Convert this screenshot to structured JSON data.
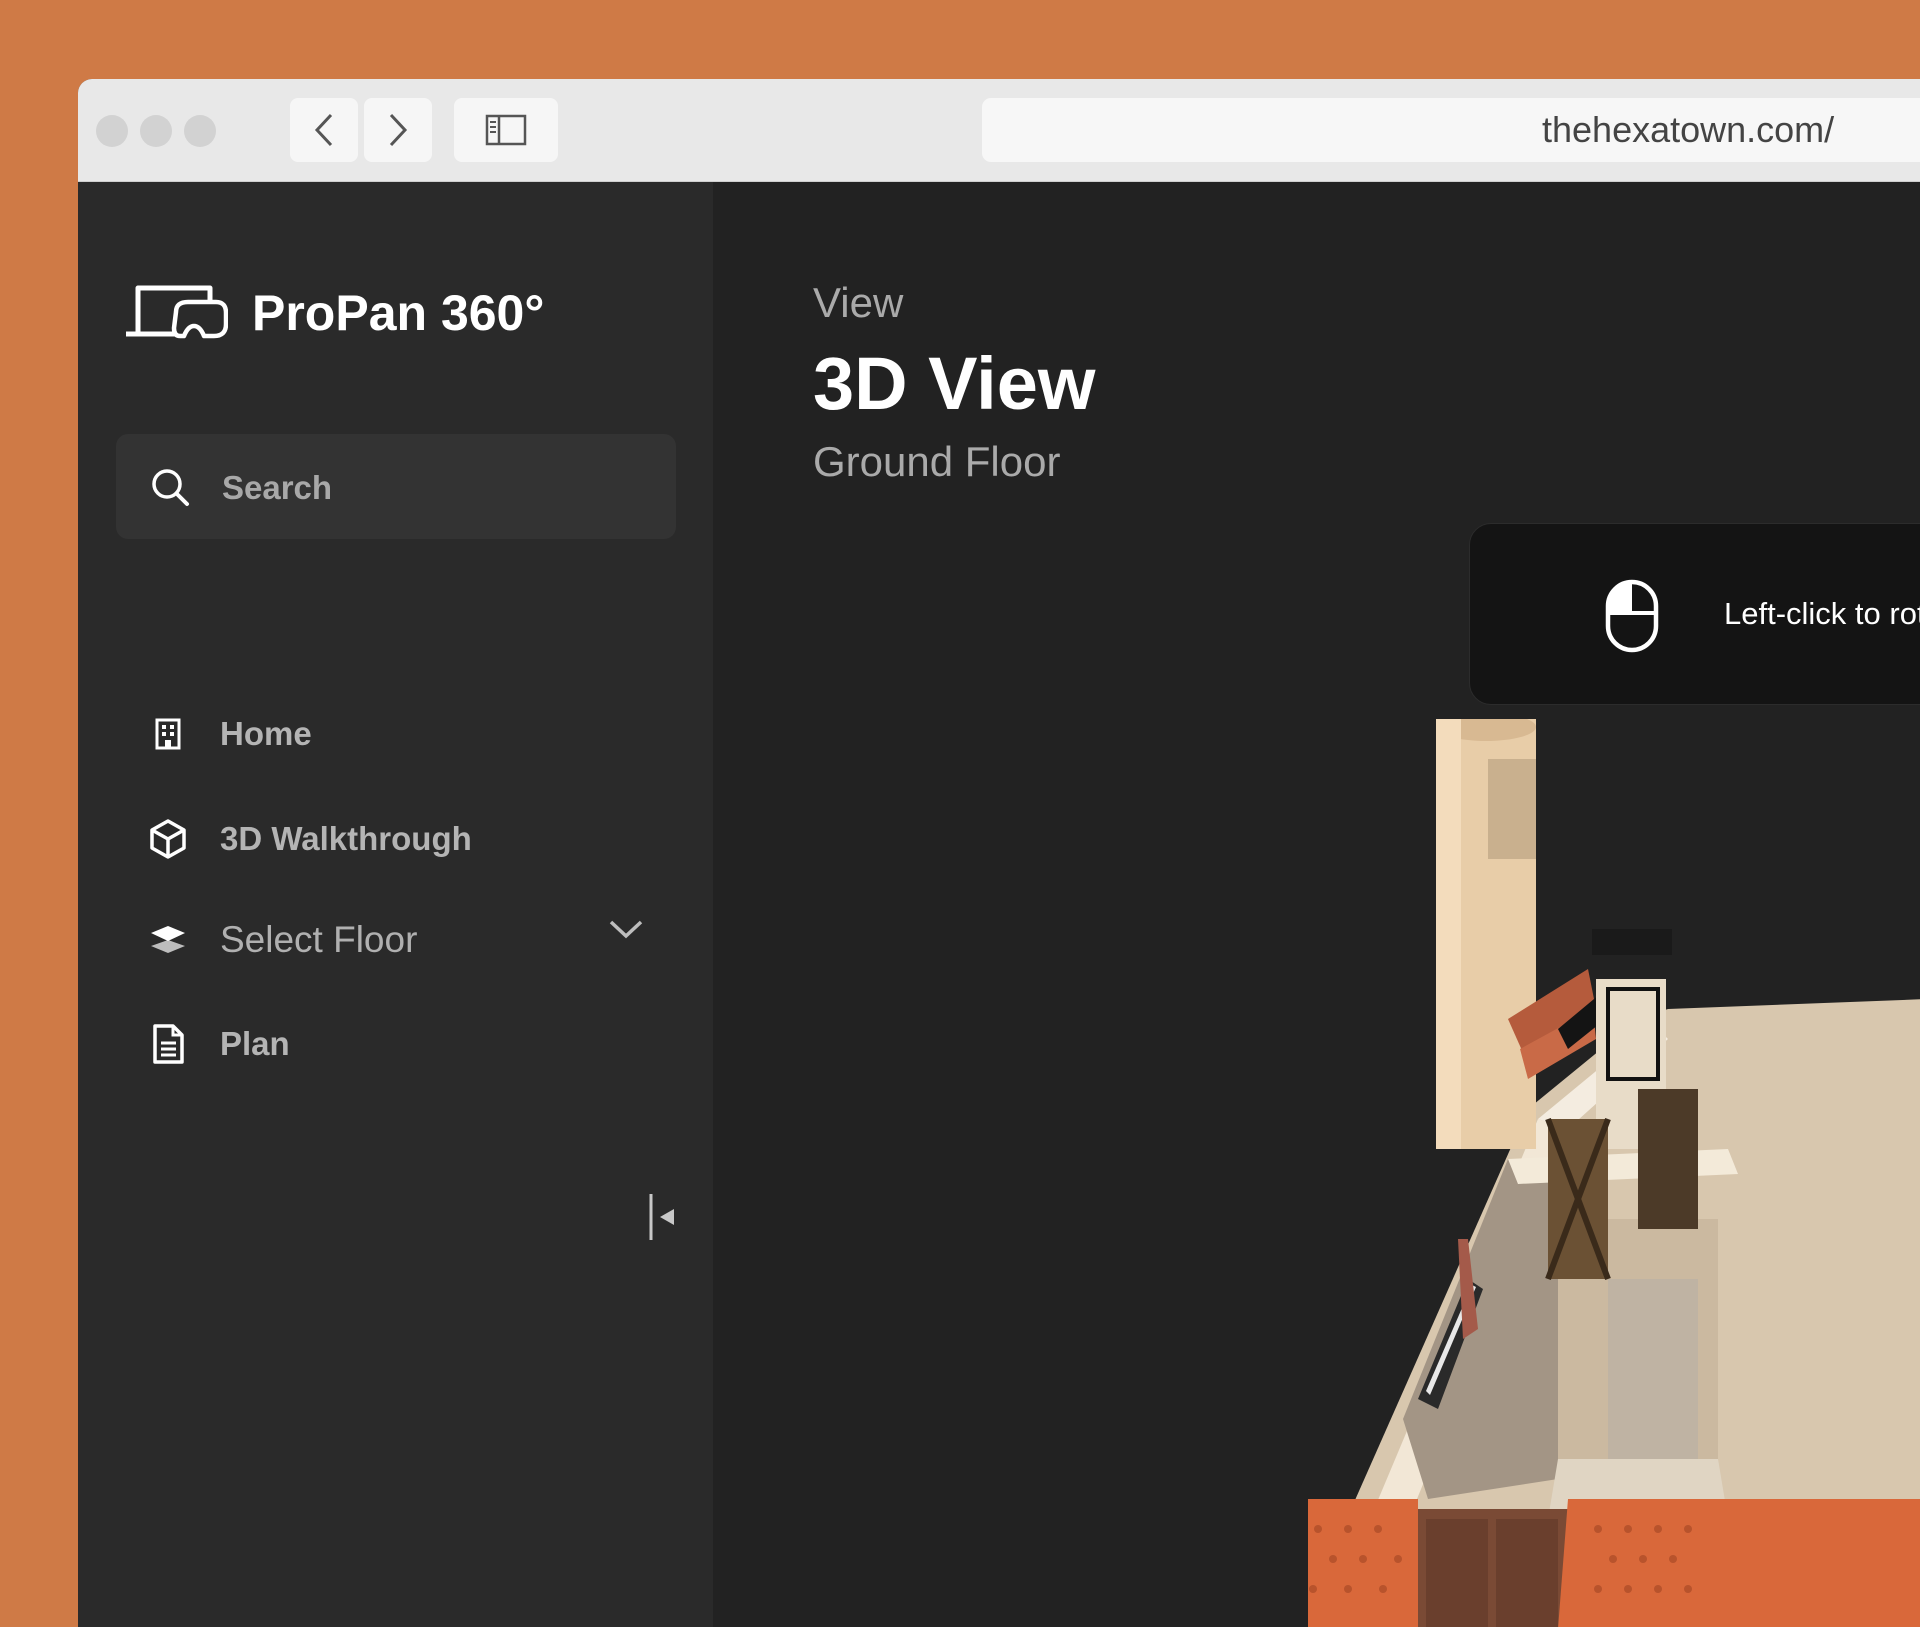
{
  "browser": {
    "url": "thehexatown.com/",
    "back_icon": "chevron-left-icon",
    "forward_icon": "chevron-right-icon",
    "sidebar_toggle_icon": "sidebar-icon"
  },
  "sidebar": {
    "brand": "ProPan 360°",
    "logo_icon": "propan-logo-icon",
    "search": {
      "placeholder": "Search",
      "icon": "search-icon"
    },
    "items": [
      {
        "label": "Home",
        "icon": "building-icon"
      },
      {
        "label": "3D Walkthrough",
        "icon": "cube-icon"
      },
      {
        "label": "Select Floor",
        "icon": "layers-icon",
        "dropdown": true
      },
      {
        "label": "Plan",
        "icon": "document-icon"
      }
    ],
    "collapse_icon": "collapse-sidebar-icon"
  },
  "main": {
    "eyebrow": "View",
    "title": "3D View",
    "subtitle": "Ground Floor",
    "hint": {
      "icon": "mouse-icon",
      "text": "Left-click to rot"
    }
  },
  "colors": {
    "backdrop": "#cf7a46",
    "sidebar_bg": "#2a2a2a",
    "main_bg": "#222222",
    "roof_tile": "#d9683a",
    "wall": "#e6d3b8"
  }
}
